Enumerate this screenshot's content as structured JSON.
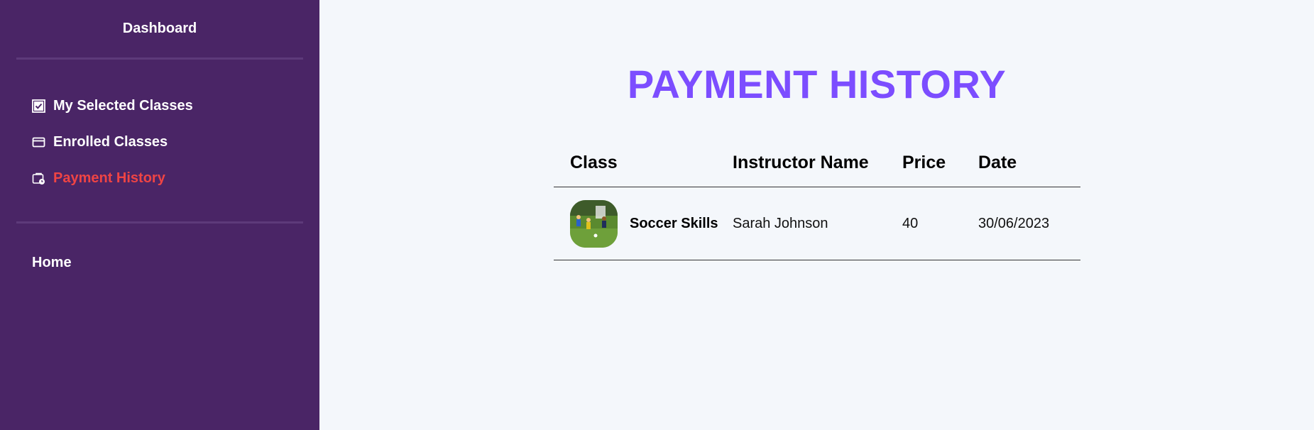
{
  "sidebar": {
    "title": "Dashboard",
    "items": [
      {
        "label": "My Selected Classes",
        "icon": "checkbox-icon",
        "active": false
      },
      {
        "label": "Enrolled Classes",
        "icon": "card-icon",
        "active": false
      },
      {
        "label": "Payment History",
        "icon": "wallet-clock-icon",
        "active": true
      }
    ],
    "secondary": [
      {
        "label": "Home"
      }
    ],
    "colors": {
      "background": "#4a2566",
      "active": "#ef4444"
    }
  },
  "main": {
    "title": "PAYMENT HISTORY",
    "title_color": "#7c4dff",
    "table": {
      "headers": [
        "Class",
        "Instructor Name",
        "Price",
        "Date"
      ],
      "rows": [
        {
          "class": "Soccer Skills",
          "thumbnail": "soccer-field-photo",
          "instructor": "Sarah Johnson",
          "price": "40",
          "date": "30/06/2023"
        }
      ]
    }
  }
}
